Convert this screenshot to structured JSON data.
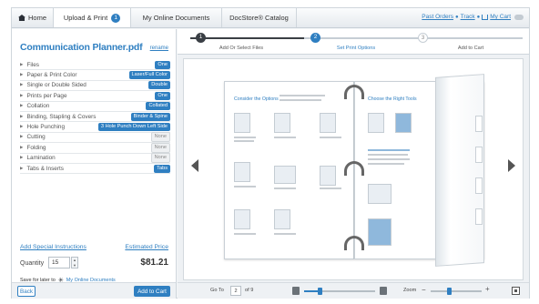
{
  "nav": {
    "tabs": [
      {
        "label": "Home"
      },
      {
        "label": "Upload & Print",
        "badge": "1"
      },
      {
        "label": "My Online Documents"
      },
      {
        "label": "DocStore® Catalog"
      }
    ],
    "links": {
      "past_orders": "Past Orders",
      "track": "Track",
      "cart": "My Cart"
    }
  },
  "document": {
    "title": "Communication Planner.pdf",
    "rename": "rename"
  },
  "options": [
    {
      "label": "Files",
      "value": "One",
      "style": "blue"
    },
    {
      "label": "Paper & Print Color",
      "value": "Laser/Full Color",
      "style": "blue"
    },
    {
      "label": "Single or Double Sided",
      "value": "Double",
      "style": "blue"
    },
    {
      "label": "Prints per Page",
      "value": "One",
      "style": "blue"
    },
    {
      "label": "Collation",
      "value": "Collated",
      "style": "blue"
    },
    {
      "label": "Binding, Stapling & Covers",
      "value": "Binder & Spine",
      "style": "blue"
    },
    {
      "label": "Hole Punching",
      "value": "3 Hole Punch Down Left Side",
      "style": "blue"
    },
    {
      "label": "Cutting",
      "value": "None",
      "style": "gray"
    },
    {
      "label": "Folding",
      "value": "None",
      "style": "gray"
    },
    {
      "label": "Lamination",
      "value": "None",
      "style": "gray"
    },
    {
      "label": "Tabs & Inserts",
      "value": "Tabs",
      "style": "blue"
    }
  ],
  "order": {
    "special_instructions": "Add Special Instructions",
    "estimated_price_label": "Estimated Price",
    "quantity_label": "Quantity",
    "quantity": "15",
    "price": "$81.21",
    "save_later": "Save for later to",
    "save_later_link": "My Online Documents",
    "back": "Back",
    "add_to_cart": "Add to Cart"
  },
  "steps": [
    {
      "num": "1",
      "label": "Add Or Select Files",
      "state": "done"
    },
    {
      "num": "2",
      "label": "Set Print Options",
      "state": "active"
    },
    {
      "num": "3",
      "label": "Add to Cart",
      "state": "todo"
    }
  ],
  "preview": {
    "left_heading": "Consider the Options",
    "right_heading": "Choose the Right Tools",
    "goto_label": "Go To",
    "current_page": "2",
    "page_total": "of 9",
    "zoom_label": "Zoom",
    "page_progress": 0.22,
    "zoom_level": 0.35
  },
  "colors": {
    "accent": "#2f7fc1"
  }
}
